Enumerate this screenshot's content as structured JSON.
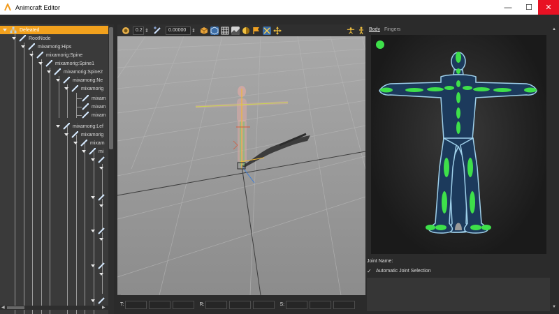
{
  "window": {
    "title": "Animcraft Editor",
    "minimize": "—",
    "maximize": "☐",
    "close": "✕"
  },
  "tree": {
    "items": [
      {
        "label": "Defeated",
        "selected": true
      },
      {
        "label": "RootNode"
      },
      {
        "label": "mixamorig:Hips"
      },
      {
        "label": "mixamorig:Spine"
      },
      {
        "label": "mixamorig:Spine1"
      },
      {
        "label": "mixamorig:Spine2"
      },
      {
        "label": "mixamorig:Ne"
      },
      {
        "label": "mixamorig"
      },
      {
        "label": "mixam"
      },
      {
        "label": "mixam"
      },
      {
        "label": "mixam"
      },
      {
        "label": "mixamorig:Lef"
      },
      {
        "label": "mixamorig"
      },
      {
        "label": "mixam"
      },
      {
        "label": "mi"
      }
    ]
  },
  "toolbar": {
    "field1_value": "0.2",
    "field2_value": "0.00000"
  },
  "coords": {
    "t_label": "T:",
    "r_label": "R:",
    "s_label": "S:"
  },
  "right_panel": {
    "tabs": [
      "Body",
      "Fingers"
    ],
    "active_tab": "Body",
    "joint_name_label": "Joint Name:",
    "auto_joint_label": "Automatic Joint Selection",
    "auto_joint_checked": true
  },
  "colors": {
    "selected_row": "#f2a11d",
    "joint_green": "#3ee04a",
    "body_fill": "#1c3a5c",
    "body_outline": "#9fd0ea",
    "close_button": "#e81123"
  }
}
